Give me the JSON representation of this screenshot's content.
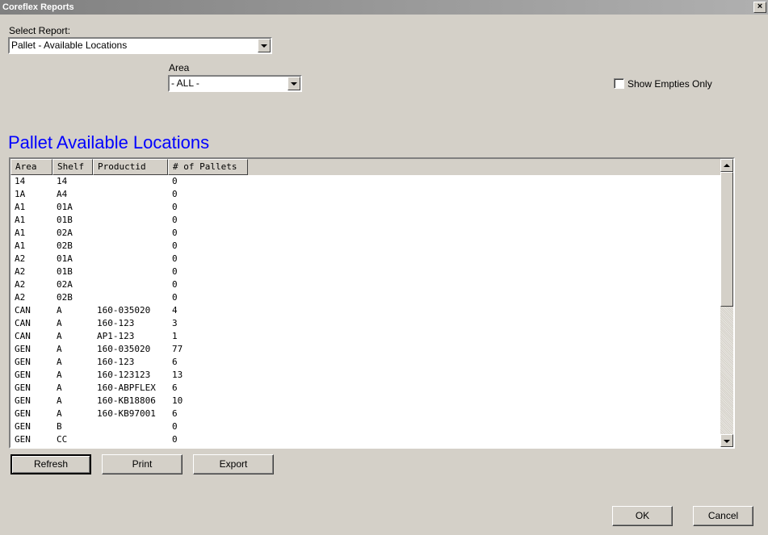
{
  "window": {
    "title": "Coreflex Reports",
    "close": "×"
  },
  "report_select": {
    "label": "Select Report:",
    "value": "Pallet - Available Locations"
  },
  "area_select": {
    "label": "Area",
    "value": "- ALL -"
  },
  "show_empties": {
    "label": "Show Empties Only",
    "checked": false
  },
  "heading": "Pallet Available Locations",
  "table": {
    "columns": [
      "Area",
      "Shelf",
      "Productid",
      "# of Pallets"
    ],
    "rows": [
      [
        "14",
        "14",
        "",
        "0"
      ],
      [
        "1A",
        "A4",
        "",
        "0"
      ],
      [
        "A1",
        "01A",
        "",
        "0"
      ],
      [
        "A1",
        "01B",
        "",
        "0"
      ],
      [
        "A1",
        "02A",
        "",
        "0"
      ],
      [
        "A1",
        "02B",
        "",
        "0"
      ],
      [
        "A2",
        "01A",
        "",
        "0"
      ],
      [
        "A2",
        "01B",
        "",
        "0"
      ],
      [
        "A2",
        "02A",
        "",
        "0"
      ],
      [
        "A2",
        "02B",
        "",
        "0"
      ],
      [
        "CAN",
        "A",
        "160-035020",
        "4"
      ],
      [
        "CAN",
        "A",
        "160-123",
        "3"
      ],
      [
        "CAN",
        "A",
        "AP1-123",
        "1"
      ],
      [
        "GEN",
        "A",
        "160-035020",
        "77"
      ],
      [
        "GEN",
        "A",
        "160-123",
        "6"
      ],
      [
        "GEN",
        "A",
        "160-123123",
        "13"
      ],
      [
        "GEN",
        "A",
        "160-ABPFLEX",
        "6"
      ],
      [
        "GEN",
        "A",
        "160-KB18806",
        "10"
      ],
      [
        "GEN",
        "A",
        "160-KB97001",
        "6"
      ],
      [
        "GEN",
        "B",
        "",
        "0"
      ],
      [
        "GEN",
        "CC",
        "",
        "0"
      ]
    ]
  },
  "buttons": {
    "refresh": "Refresh",
    "print": "Print",
    "export": "Export",
    "ok": "OK",
    "cancel": "Cancel"
  }
}
